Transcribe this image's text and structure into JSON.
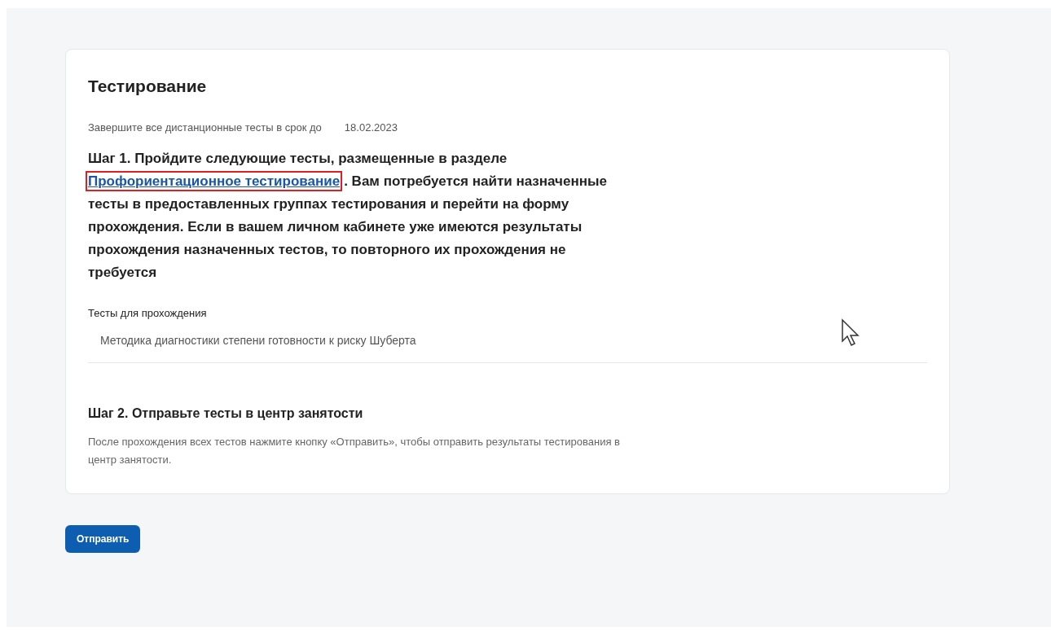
{
  "card": {
    "title": "Тестирование",
    "deadline": {
      "label": "Завершите все дистанционные тесты в срок до",
      "date": "18.02.2023"
    },
    "step1": {
      "before": "Шаг 1. Пройдите следующие тесты, размещенные в разделе",
      "link": "Профориентационное тестирование",
      "after": ". Вам потребуется найти назначенные тесты в предоставленных группах тестирования и перейти на форму прохождения. Если в вашем личном кабинете уже имеются результаты прохождения назначенных тестов, то повторного их прохождения не требуется"
    },
    "tests": {
      "label": "Тесты для прохождения",
      "items": [
        "Методика диагностики степени готовности к риску Шуберта"
      ]
    },
    "step2": {
      "title": "Шаг 2. Отправьте тесты в центр занятости",
      "text": "После прохождения всех тестов нажмите кнопку «Отправить», чтобы отправить результаты тестирования в центр занятости."
    }
  },
  "submit_button": "Отправить"
}
